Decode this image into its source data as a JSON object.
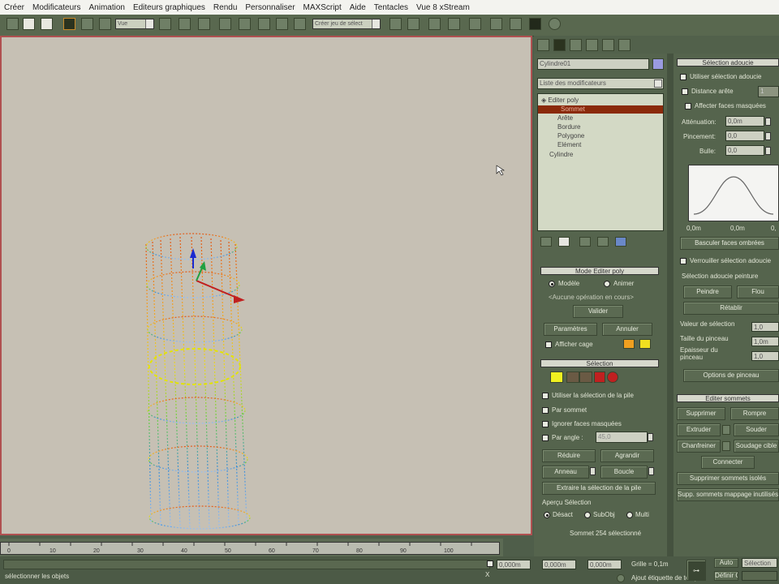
{
  "menubar": [
    "Créer",
    "Modificateurs",
    "Animation",
    "Editeurs graphiques",
    "Rendu",
    "Personnaliser",
    "MAXScript",
    "Aide",
    "Tentacles",
    "Vue 8 xStream"
  ],
  "toolbar": {
    "view_combo": "Vue",
    "selection_set_placeholder": "Créer jeu de sélect"
  },
  "object_name": "Cylindre01",
  "modifier_list_label": "Liste des modificateurs",
  "stack": {
    "editable_poly": "Editer poly",
    "items": [
      "Sommet",
      "Arête",
      "Bordure",
      "Polygone",
      "Elément"
    ],
    "base": "Cylindre"
  },
  "edit_poly_mode": {
    "title": "Mode Editer poly",
    "modele": "Modèle",
    "animer": "Animer",
    "no_current_op": "<Aucune opération en cours>",
    "valider": "Valider",
    "parametres": "Paramètres",
    "annuler": "Annuler",
    "afficher_cage": "Afficher cage"
  },
  "selection": {
    "title": "Sélection",
    "use_stack": "Utiliser la sélection de la pile",
    "by_vertex": "Par sommet",
    "ignore_back": "Ignorer faces masquées",
    "by_angle": "Par angle :",
    "by_angle_value": "45,0",
    "reduce": "Réduire",
    "grow": "Agrandir",
    "ring": "Anneau",
    "loop": "Boucle",
    "get_stack": "Extraire la sélection de la pile",
    "preview": "Aperçu Sélection",
    "off": "Désact",
    "subobj": "SubObj",
    "multi": "Multi",
    "status": "Sommet 254 sélectionné"
  },
  "soft_selection": {
    "title": "Sélection adoucie",
    "use": "Utiliser sélection adoucie",
    "edge_distance": "Distance arête",
    "edge_distance_value": "1",
    "affect_back": "Affecter faces masquées",
    "falloff": "Atténuation:",
    "falloff_value": "0,0m",
    "pinch": "Pincement:",
    "pinch_value": "0,0",
    "bubble": "Bulle:",
    "bubble_value": "0,0",
    "curve_ticks": [
      "0,0m",
      "0,0m",
      "0,"
    ],
    "shaded_face": "Basculer faces ombrées",
    "lock": "Verrouiller sélection adoucie",
    "paint_title": "Sélection adoucie peinture",
    "paint": "Peindre",
    "blur": "Flou",
    "revert": "Rétablir",
    "sel_value": "Valeur de sélection",
    "sel_value_v": "1,0",
    "brush_size": "Taille du pinceau",
    "brush_size_v": "1,0m",
    "brush_strength": "Epaisseur du pinceau",
    "brush_strength_v": "1,0",
    "brush_options": "Options de pinceau"
  },
  "edit_vertices": {
    "title": "Editer sommets",
    "remove": "Supprimer",
    "break": "Rompre",
    "extrude": "Extruder",
    "weld": "Souder",
    "chamfer": "Chanfreiner",
    "target_weld": "Soudage cible",
    "connect": "Connecter",
    "remove_isolated": "Supprimer sommets isolés",
    "remove_unused": "Supp. sommets mappage inutilisés"
  },
  "ruler_ticks": [
    "0",
    "10",
    "20",
    "30",
    "40",
    "50",
    "60",
    "70",
    "80",
    "90",
    "100"
  ],
  "status": {
    "x": "0,000m",
    "y": "0,000m",
    "z": "0,000m",
    "grid": "Grille = 0,1m",
    "prompt": "sélectionner les objets",
    "key_mode": "Auto",
    "set_key": "Définir C",
    "selection_label": "Sélection",
    "add_time_tag": "Ajout étiquette de temps"
  }
}
